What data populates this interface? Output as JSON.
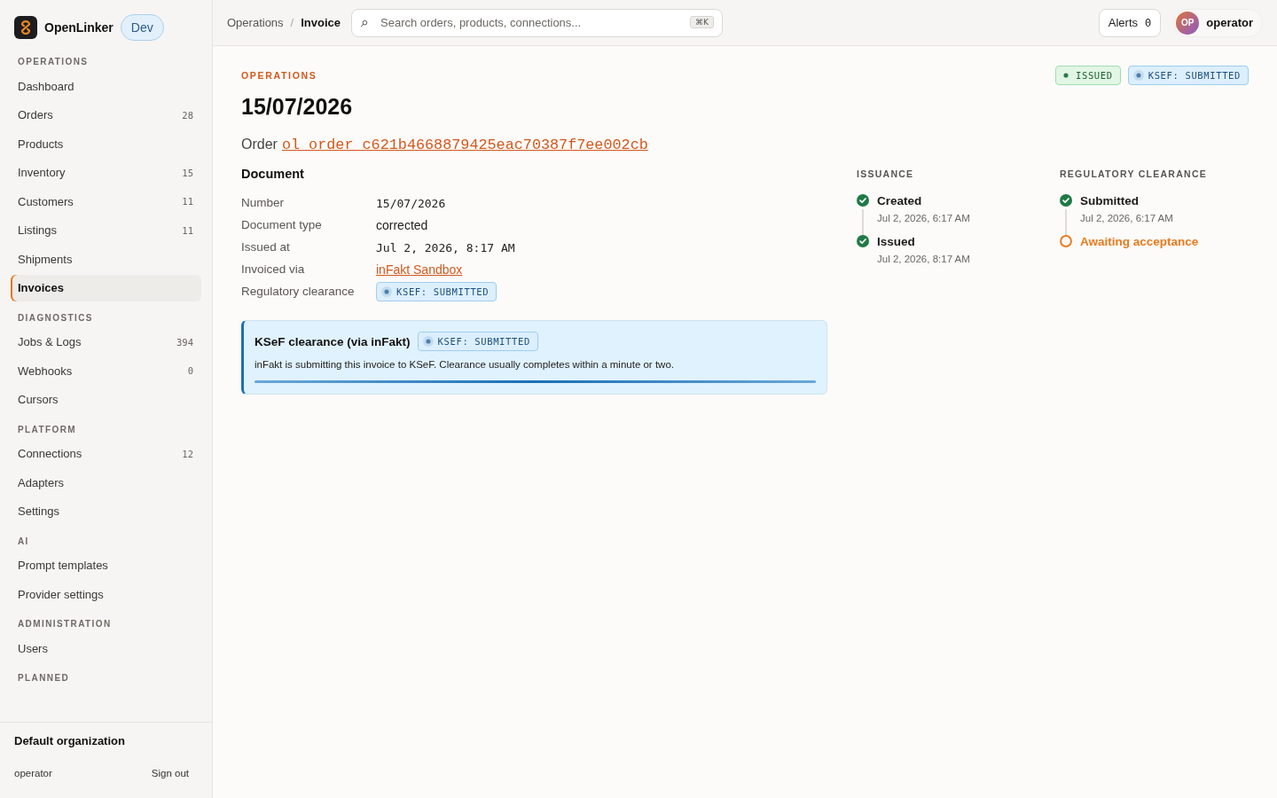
{
  "brand": {
    "name": "OpenLinker",
    "env": "Dev"
  },
  "sidebar": {
    "sections": [
      {
        "title": "OPERATIONS",
        "items": [
          {
            "label": "Dashboard",
            "selected": false
          },
          {
            "label": "Orders",
            "count": "28",
            "selected": false
          },
          {
            "label": "Products",
            "selected": false
          },
          {
            "label": "Inventory",
            "count": "15",
            "selected": false
          },
          {
            "label": "Customers",
            "count": "11",
            "selected": false
          },
          {
            "label": "Listings",
            "count": "11",
            "selected": false
          },
          {
            "label": "Shipments",
            "selected": false
          },
          {
            "label": "Invoices",
            "selected": true
          }
        ]
      },
      {
        "title": "DIAGNOSTICS",
        "items": [
          {
            "label": "Jobs & Logs",
            "count": "394",
            "selected": false
          },
          {
            "label": "Webhooks",
            "count": "0",
            "selected": false
          },
          {
            "label": "Cursors",
            "selected": false
          }
        ]
      },
      {
        "title": "PLATFORM",
        "items": [
          {
            "label": "Connections",
            "count": "12",
            "selected": false
          },
          {
            "label": "Adapters",
            "selected": false
          },
          {
            "label": "Settings",
            "selected": false
          }
        ]
      },
      {
        "title": "AI",
        "items": [
          {
            "label": "Prompt templates",
            "selected": false
          },
          {
            "label": "Provider settings",
            "selected": false
          }
        ]
      },
      {
        "title": "ADMINISTRATION",
        "items": [
          {
            "label": "Users",
            "selected": false
          }
        ]
      },
      {
        "title": "PLANNED"
      }
    ],
    "footer": {
      "organization": "Default organization",
      "user": "operator",
      "sign_out": "Sign out"
    }
  },
  "topbar": {
    "breadcrumb": [
      {
        "label": "Operations",
        "current": false
      },
      {
        "label": "Invoice",
        "current": true
      }
    ],
    "separator": "/",
    "search": {
      "placeholder": "Search orders, products, connections...",
      "shortcut": "⌘K"
    },
    "alerts": {
      "label": "Alerts",
      "count": "0"
    },
    "user": {
      "initials": "OP",
      "name": "operator"
    }
  },
  "page": {
    "eyebrow": "OPERATIONS",
    "title": "15/07/2026",
    "order_label": "Order",
    "order_id": "ol_order_c621b4668879425eac70387f7ee002cb",
    "badges": [
      {
        "label": "ISSUED",
        "kind": "success"
      },
      {
        "label": "KSEF: SUBMITTED",
        "kind": "info"
      }
    ]
  },
  "document": {
    "title": "Document",
    "fields": [
      {
        "label": "Number",
        "value": "15/07/2026",
        "kind": "mono"
      },
      {
        "label": "Document type",
        "value": "corrected",
        "kind": "text"
      },
      {
        "label": "Issued at",
        "value": "Jul 2, 2026, 8:17 AM",
        "kind": "mono"
      },
      {
        "label": "Invoiced via",
        "value": "inFakt Sandbox",
        "kind": "link"
      },
      {
        "label": "Regulatory clearance",
        "kind": "badge",
        "badge": {
          "label": "KSEF: SUBMITTED",
          "kind": "info"
        }
      }
    ]
  },
  "callout": {
    "title": "KSeF clearance (via inFakt)",
    "badge": {
      "label": "KSEF: SUBMITTED",
      "kind": "info"
    },
    "text": "inFakt is submitting this invoice to KSeF. Clearance usually completes within a minute or two.",
    "level": 1
  },
  "timelines": [
    {
      "title": "ISSUANCE",
      "steps": [
        {
          "label": "Created",
          "time": "Jul 2, 2026, 6:17 AM",
          "done": true
        },
        {
          "label": "Issued",
          "time": "Jul 2, 2026, 8:17 AM",
          "done": true
        }
      ]
    },
    {
      "title": "REGULATORY CLEARANCE",
      "steps": [
        {
          "label": "Submitted",
          "time": "Jul 2, 2026, 6:17 AM",
          "done": true
        },
        {
          "label": "Awaiting acceptance",
          "done": false
        }
      ]
    }
  ]
}
